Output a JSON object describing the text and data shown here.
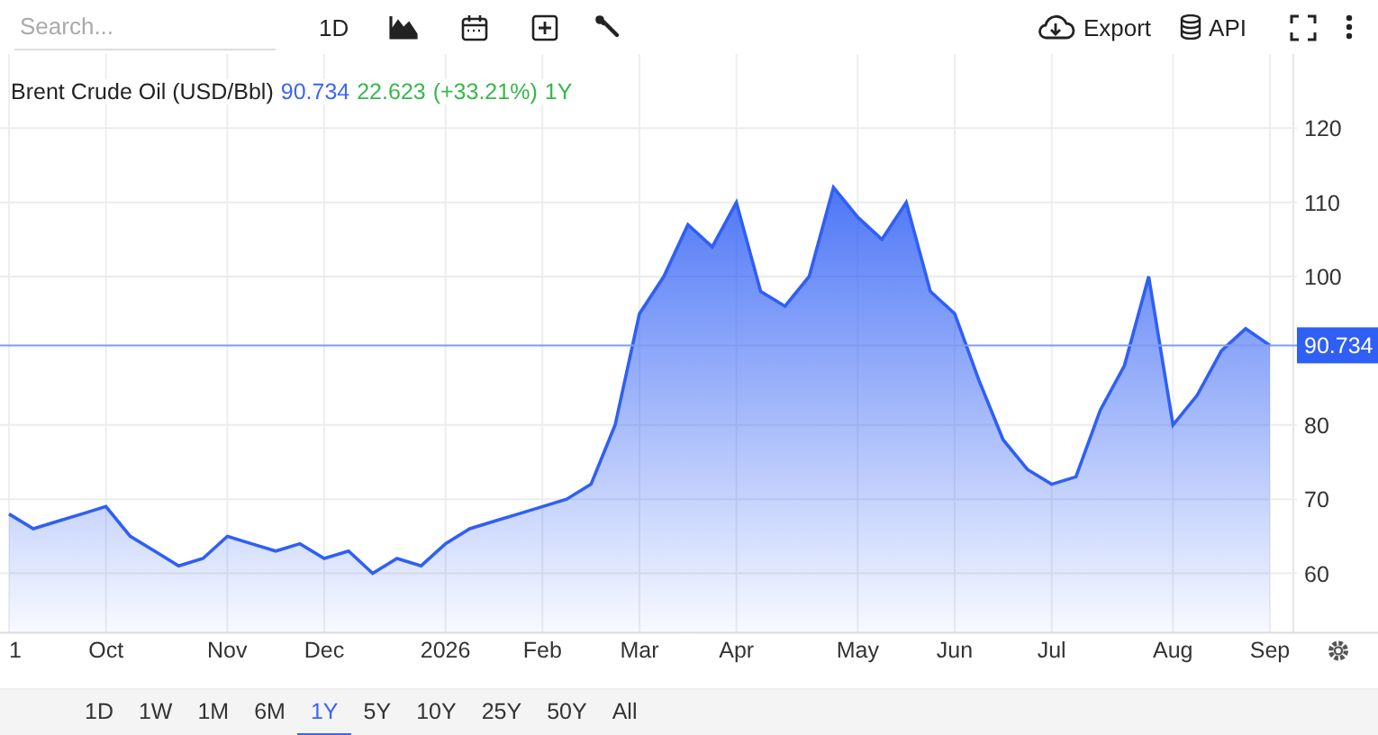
{
  "toolbar": {
    "search": {
      "placeholder": "Search..."
    },
    "interval": "1D",
    "export": "Export",
    "api": "API"
  },
  "legend": {
    "price": "90.734",
    "change": "22.623",
    "change_percent": "(+33.21%)",
    "period": "1Y"
  },
  "chart": {
    "chart_data": {
      "type": "area",
      "categories": [
        "1",
        null,
        null,
        null,
        "Oct",
        null,
        null,
        null,
        null,
        "Nov",
        null,
        null,
        null,
        "Dec",
        null,
        null,
        null,
        null,
        "2026",
        null,
        null,
        null,
        "Feb",
        null,
        null,
        null,
        "Mar",
        null,
        null,
        null,
        "Apr",
        null,
        null,
        null,
        null,
        "May",
        null,
        null,
        null,
        "Jun",
        null,
        null,
        null,
        "Jul",
        null,
        null,
        null,
        null,
        "Aug",
        null,
        null,
        null,
        "Sep"
      ],
      "series": [
        {
          "name": "Brent Crude Oil (USD/Bbl)",
          "color": "#2f5ff5",
          "values": [
            68,
            66,
            67,
            68,
            69,
            65,
            63,
            61,
            62,
            65,
            64,
            63,
            64,
            62,
            63,
            60,
            62,
            61,
            64,
            66,
            67,
            68,
            69,
            70,
            72,
            80,
            95,
            100,
            107,
            104,
            110,
            98,
            96,
            100,
            112,
            108,
            105,
            110,
            98,
            95,
            86,
            78,
            74,
            72,
            73,
            82,
            88,
            100,
            80,
            84,
            90,
            93,
            90.7
          ]
        }
      ],
      "ylim": [
        52,
        130
      ],
      "yticks": [
        60,
        70,
        80,
        100,
        110,
        120
      ],
      "grid": true,
      "ref_lines": [
        {
          "axis": "y",
          "value": 90.734,
          "label": "90.734",
          "color": "#7f9cf5"
        }
      ]
    }
  },
  "ranges": [
    {
      "label": "1D",
      "selected": false
    },
    {
      "label": "1W",
      "selected": false
    },
    {
      "label": "1M",
      "selected": false
    },
    {
      "label": "6M",
      "selected": false
    },
    {
      "label": "1Y",
      "selected": true
    },
    {
      "label": "5Y",
      "selected": false
    },
    {
      "label": "10Y",
      "selected": false
    },
    {
      "label": "25Y",
      "selected": false
    },
    {
      "label": "50Y",
      "selected": false
    },
    {
      "label": "All",
      "selected": false
    }
  ]
}
